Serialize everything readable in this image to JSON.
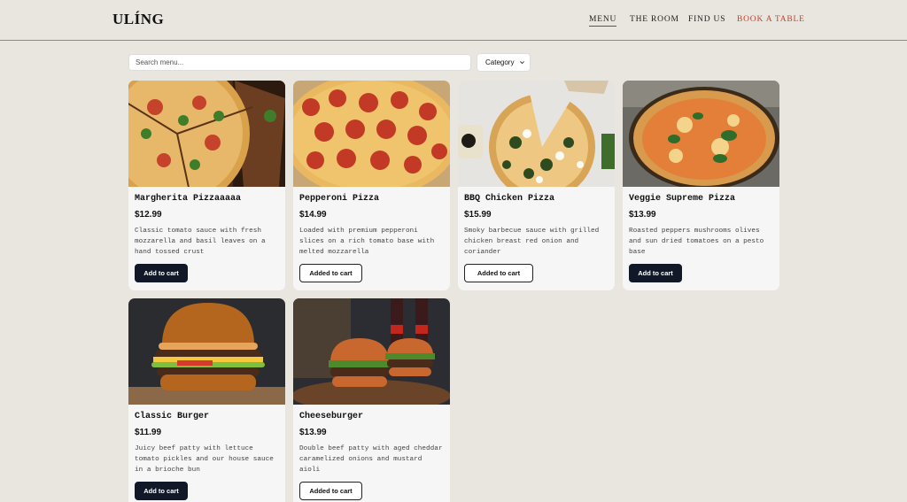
{
  "header": {
    "brand": "ULÍNG",
    "nav": [
      {
        "label": "MENU",
        "active": true
      },
      {
        "label": "THE ROOM",
        "active": false
      },
      {
        "label": "FIND US",
        "active": false
      },
      {
        "label": "BOOK A TABLE",
        "active": false
      }
    ]
  },
  "filters": {
    "search_placeholder": "Search menu...",
    "category_label": "Category"
  },
  "colors": {
    "background": "#e9e6e0",
    "card": "#f6f6f6",
    "primary_button": "#111827",
    "cta": "#c2412e"
  },
  "items": [
    {
      "name": "Margherita Pizzaaaaa",
      "price": "$12.99",
      "description": "Classic tomato sauce with fresh mozzarella and basil leaves on a hand tossed crust",
      "button": "Add to cart",
      "in_cart": false,
      "image": "pizza-slices-image"
    },
    {
      "name": "Pepperoni Pizza",
      "price": "$14.99",
      "description": "Loaded with premium pepperoni slices on a rich tomato base with melted mozzarella",
      "button": "Added to cart",
      "in_cart": true,
      "image": "pepperoni-pizza-image"
    },
    {
      "name": "BBQ Chicken Pizza",
      "price": "$15.99",
      "description": "Smoky barbecue sauce with grilled chicken breast red onion and coriander",
      "button": "Added to cart",
      "in_cart": true,
      "image": "spinach-pizza-image"
    },
    {
      "name": "Veggie Supreme Pizza",
      "price": "$13.99",
      "description": "Roasted peppers mushrooms olives and sun dried tomatoes on a pesto base",
      "button": "Add to cart",
      "in_cart": false,
      "image": "basil-pizza-image"
    },
    {
      "name": "Classic Burger",
      "price": "$11.99",
      "description": "Juicy beef patty with lettuce tomato pickles and our house sauce in a brioche bun",
      "button": "Add to cart",
      "in_cart": false,
      "image": "burger-image"
    },
    {
      "name": "Cheeseburger",
      "price": "$13.99",
      "description": "Double beef patty with aged cheddar caramelized onions and mustard aioli",
      "button": "Added to cart",
      "in_cart": true,
      "image": "sliders-image"
    }
  ]
}
